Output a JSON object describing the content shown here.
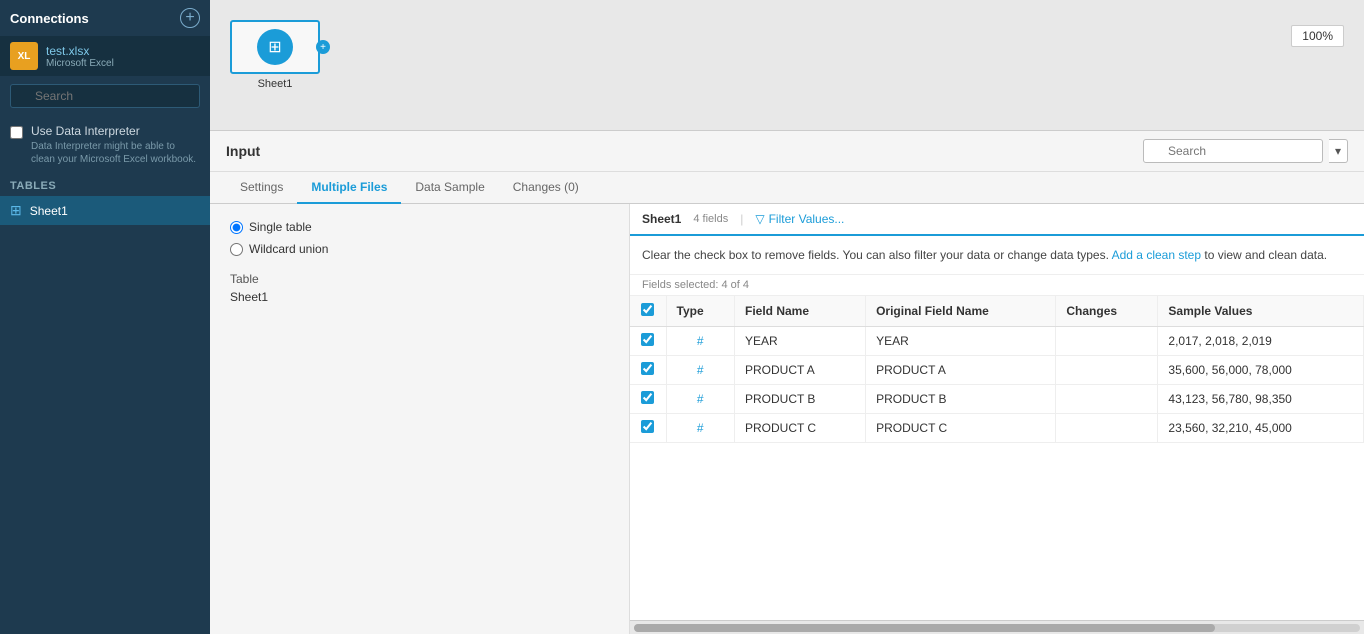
{
  "sidebar": {
    "title": "Connections",
    "add_button_label": "+",
    "connection": {
      "name": "test.xlsx",
      "type": "Microsoft Excel"
    },
    "search_placeholder": "Search",
    "tables_label": "Tables",
    "use_data_interpreter": {
      "label": "Use Data Interpreter",
      "description": "Data Interpreter might be able to clean your Microsoft Excel workbook."
    },
    "table_item": "Sheet1"
  },
  "canvas": {
    "node_label": "Sheet1",
    "zoom": "100%"
  },
  "input": {
    "title": "Input",
    "search_placeholder": "Search",
    "tabs": [
      {
        "label": "Settings",
        "active": false
      },
      {
        "label": "Multiple Files",
        "active": true
      },
      {
        "label": "Data Sample",
        "active": false
      },
      {
        "label": "Changes (0)",
        "active": false
      }
    ],
    "radio_options": [
      {
        "label": "Single table",
        "selected": true
      },
      {
        "label": "Wildcard union",
        "selected": false
      }
    ],
    "table_section": {
      "label": "Table",
      "value": "Sheet1"
    }
  },
  "data_panel": {
    "sheet_name": "Sheet1",
    "fields_count": "4 fields",
    "filter_button": "Filter Values...",
    "info_text": "Clear the check box to remove fields. You can also filter your data or change data types.",
    "add_clean_step_link": "Add a clean step",
    "info_text2": "to view and clean data.",
    "fields_selected": "Fields selected: 4 of 4",
    "table": {
      "headers": [
        "",
        "Type",
        "Field Name",
        "Original Field Name",
        "Changes",
        "Sample Values"
      ],
      "rows": [
        {
          "checked": true,
          "type": "#",
          "field_name": "YEAR",
          "original": "YEAR",
          "changes": "",
          "sample": "2,017, 2,018, 2,019"
        },
        {
          "checked": true,
          "type": "#",
          "field_name": "PRODUCT A",
          "original": "PRODUCT A",
          "changes": "",
          "sample": "35,600, 56,000, 78,000"
        },
        {
          "checked": true,
          "type": "#",
          "field_name": "PRODUCT B",
          "original": "PRODUCT B",
          "changes": "",
          "sample": "43,123, 56,780, 98,350"
        },
        {
          "checked": true,
          "type": "#",
          "field_name": "PRODUCT C",
          "original": "PRODUCT C",
          "changes": "",
          "sample": "23,560, 32,210, 45,000"
        }
      ]
    }
  }
}
